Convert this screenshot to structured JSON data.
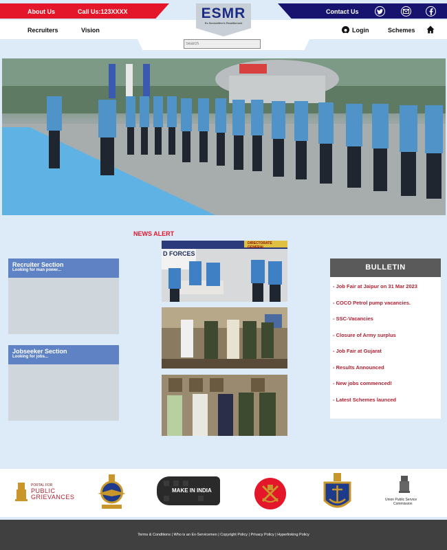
{
  "top": {
    "about": "About Us",
    "call": "Call Us:123XXXX",
    "contact": "Contact Us"
  },
  "nav": {
    "recruiters": "Recruiters",
    "vision": "Vision",
    "login": "Login",
    "schemes": "Schemes"
  },
  "logo": {
    "title": "ESMR",
    "subtitle": "Ex-ServiceMen's Resettlement"
  },
  "search": {
    "placeholder": "Search"
  },
  "news_alert": "NEWS ALERT",
  "recruiter": {
    "title": "Recruiter Section",
    "subtitle": "Looking for man power..."
  },
  "jobseeker": {
    "title": "Jobseeker Section",
    "subtitle": "Looking for jobs..."
  },
  "photo1": {
    "banner": "DIRECTORATE GENERAL",
    "board": "D FORCES"
  },
  "bulletin": {
    "title": "BULLETIN",
    "items": [
      "- Job Fair at Jaipur on 31 Mar 2023",
      "- COCO Petrol pump vacancies.",
      "- SSC-Vacancies",
      "- Closure of Army surplus",
      "- Job Fair at Gujarat",
      "- Results Announced",
      "- New jobs commenced!",
      "- Latest Schemes launced"
    ]
  },
  "logos": {
    "pg1": "PORTAL FOR",
    "pg2": "PUBLIC",
    "pg3": "GRIEVANCES",
    "makeinindia": "MAKE IN INDIA",
    "upsc1": "Union Public Service",
    "upsc2": "Commission"
  },
  "footer": {
    "links": [
      "Terms & Conditions",
      "Who is an Ex-Servicemen",
      "Copyright Policy",
      "Privacy Policy",
      "Hyperlinking Policy"
    ]
  },
  "colors": {
    "red": "#e3162a",
    "navy": "#16146e",
    "blue": "#5f82c4"
  }
}
